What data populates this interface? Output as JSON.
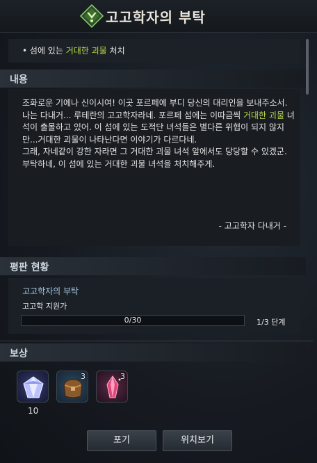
{
  "window": {
    "title": "고고학자의 부탁"
  },
  "objective": {
    "bullet": "•",
    "prefix": "섬에 있는 ",
    "highlight": "거대한 괴물",
    "suffix": " 처치"
  },
  "content": {
    "header": "내용",
    "para1": "조화로운 기에나 신이시여! 이곳 포르페에 부디 당신의 대리인을 보내주소서.",
    "para2_prefix": "나는 다내거... 루테란의 고고학자라네. 포르페 섬에는 이따금씩 ",
    "para2_highlight": "거대한 괴물",
    "para2_suffix": " 녀석이 출몰하고 있어. 이 섬에 있는 도적단 녀석들은 별다른 위협이 되지 않지만...거대한 괴물이 나타난다면 이야기가 다르다네.",
    "para3": "그래, 자네같이 강한 자라면 그 거대한 괴물 녀석 앞에서도 당당할 수 있겠군. 부탁하네, 이 섬에 있는 거대한 괴물 녀석을 처치해주게.",
    "signature": "- 고고학자 다내거 -"
  },
  "reputation": {
    "header": "평판 현황",
    "title": "고고학자의 부탁",
    "subtitle": "고고학 지원가",
    "progress_text": "0/30",
    "progress_fraction": 0,
    "stage": "1/3 단계"
  },
  "rewards": {
    "header": "보상",
    "items": [
      {
        "icon": "crystal-gem-icon",
        "badge": "",
        "quantity": "10"
      },
      {
        "icon": "leather-pouch-icon",
        "badge": "3",
        "quantity": ""
      },
      {
        "icon": "red-crystal-icon",
        "badge": "3",
        "quantity": ""
      }
    ]
  },
  "buttons": {
    "abandon": "포기",
    "locate": "위치보기"
  },
  "colors": {
    "highlight": "#b4d74a",
    "reputation_title": "#aac8e8",
    "progress_fill": "#4e86b8"
  }
}
